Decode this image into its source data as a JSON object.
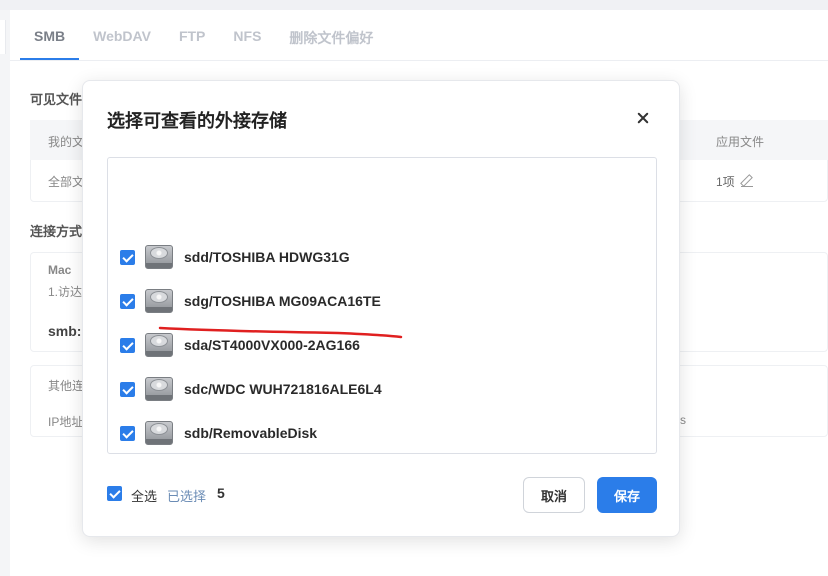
{
  "background": {
    "tabs": [
      "SMB",
      "WebDAV",
      "FTP",
      "NFS",
      "删除文件偏好"
    ],
    "active_tab": "SMB",
    "section_visible_files": "可见文件",
    "table_header": {
      "col1": "我的文",
      "col_last": "应用文件"
    },
    "table_row": {
      "col1": "全部文",
      "col_last": "1项"
    },
    "section_connection": "连接方式",
    "mac_card": {
      "title": "Mac",
      "line1": "1.访达",
      "line2": "smb:"
    },
    "other_card": {
      "title": "其他连",
      "line1": "IP地址",
      "tail": "s"
    }
  },
  "modal": {
    "title": "选择可查看的外接存储",
    "disks": [
      {
        "label": "sdd/TOSHIBA HDWG31G",
        "checked": true,
        "icon": "hard-drive-icon"
      },
      {
        "label": "sdg/TOSHIBA MG09ACA16TE",
        "checked": true,
        "icon": "hard-drive-icon"
      },
      {
        "label": "sda/ST4000VX000-2AG166",
        "checked": true,
        "icon": "hard-drive-icon"
      },
      {
        "label": "sdc/WDC WUH721816ALE6L4",
        "checked": true,
        "icon": "hard-drive-icon"
      },
      {
        "label": "sdb/RemovableDisk",
        "checked": true,
        "icon": "hard-drive-icon"
      }
    ],
    "select_all_label": "全选",
    "selected_label": "已选择",
    "selected_count": "5",
    "cancel_label": "取消",
    "save_label": "保存",
    "colors": {
      "accent": "#2b7de9",
      "annotation": "#e02020"
    }
  }
}
